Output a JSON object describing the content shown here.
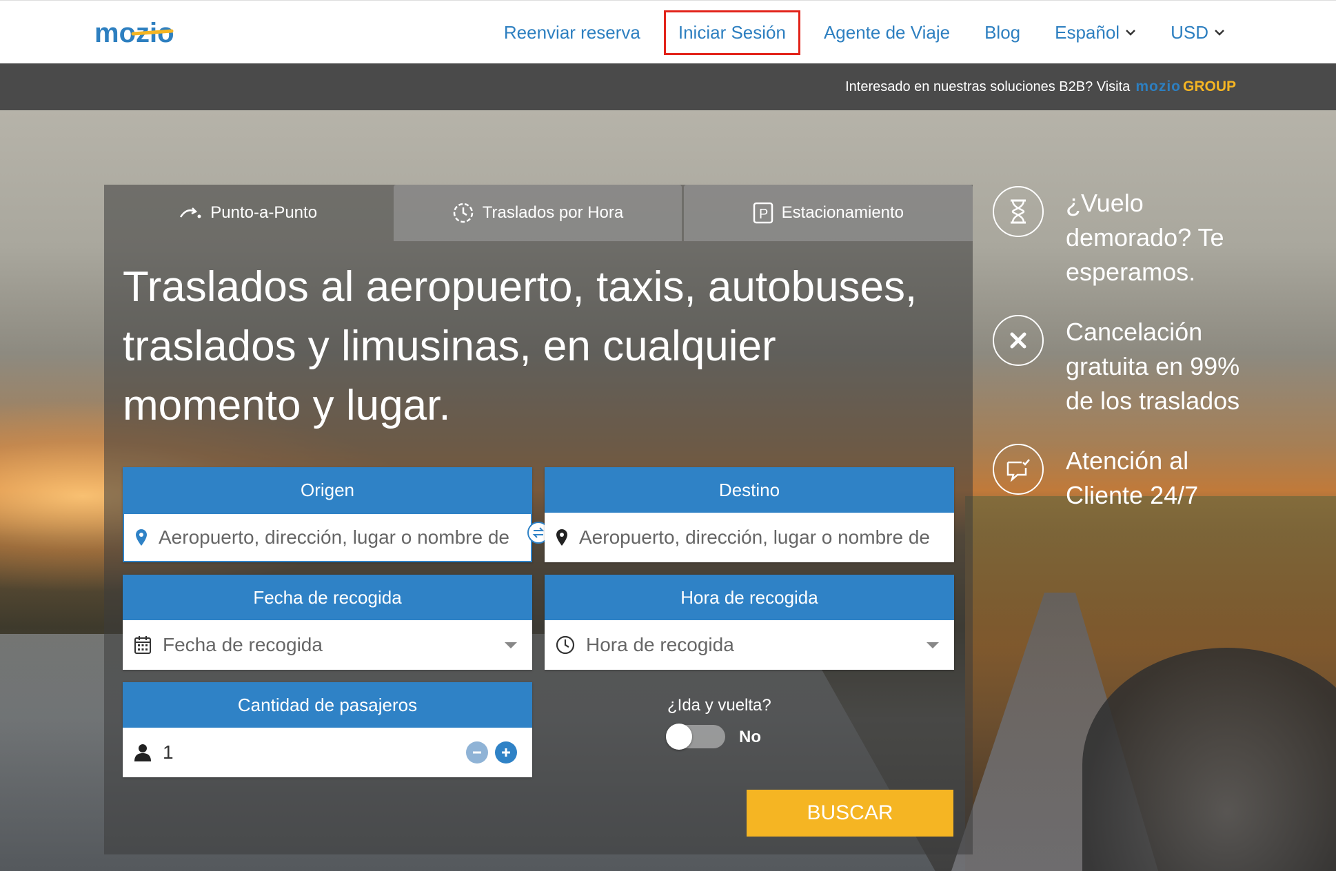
{
  "header": {
    "logo_text": "mozio",
    "nav": {
      "resend": "Reenviar reserva",
      "login": "Iniciar Sesión",
      "agent": "Agente de Viaje",
      "blog": "Blog",
      "language": "Español",
      "currency": "USD"
    }
  },
  "b2b": {
    "text": "Interesado en nuestras soluciones B2B? Visita",
    "brand_mozio": "mozio",
    "brand_group": "GROUP"
  },
  "tabs": [
    {
      "label": "Punto-a-Punto"
    },
    {
      "label": "Traslados por Hora"
    },
    {
      "label": "Estacionamiento"
    }
  ],
  "headline": "Traslados al aeropuerto, taxis, autobuses, traslados y limusinas, en cualquier momento y lugar.",
  "form": {
    "origin": {
      "label": "Origen",
      "placeholder": "Aeropuerto, dirección, lugar o nombre de"
    },
    "destination": {
      "label": "Destino",
      "placeholder": "Aeropuerto, dirección, lugar o nombre de"
    },
    "date": {
      "label": "Fecha de recogida",
      "placeholder": "Fecha de recogida"
    },
    "time": {
      "label": "Hora de recogida",
      "placeholder": "Hora de recogida"
    },
    "passengers": {
      "label": "Cantidad de pasajeros",
      "value": "1"
    },
    "roundtrip": {
      "label": "¿Ida y vuelta?",
      "state": "No"
    },
    "search": "BUSCAR"
  },
  "benefits": [
    {
      "icon": "hourglass-icon",
      "text": "¿Vuelo demorado? Te esperamos."
    },
    {
      "icon": "close-icon",
      "text": "Cancelación gratuita en 99% de los traslados"
    },
    {
      "icon": "chat-check-icon",
      "text": "Atención al Cliente 24/7"
    }
  ],
  "colors": {
    "brand_blue": "#2f82c6",
    "accent_yellow": "#f5b523",
    "highlight_red": "#e2231a"
  }
}
